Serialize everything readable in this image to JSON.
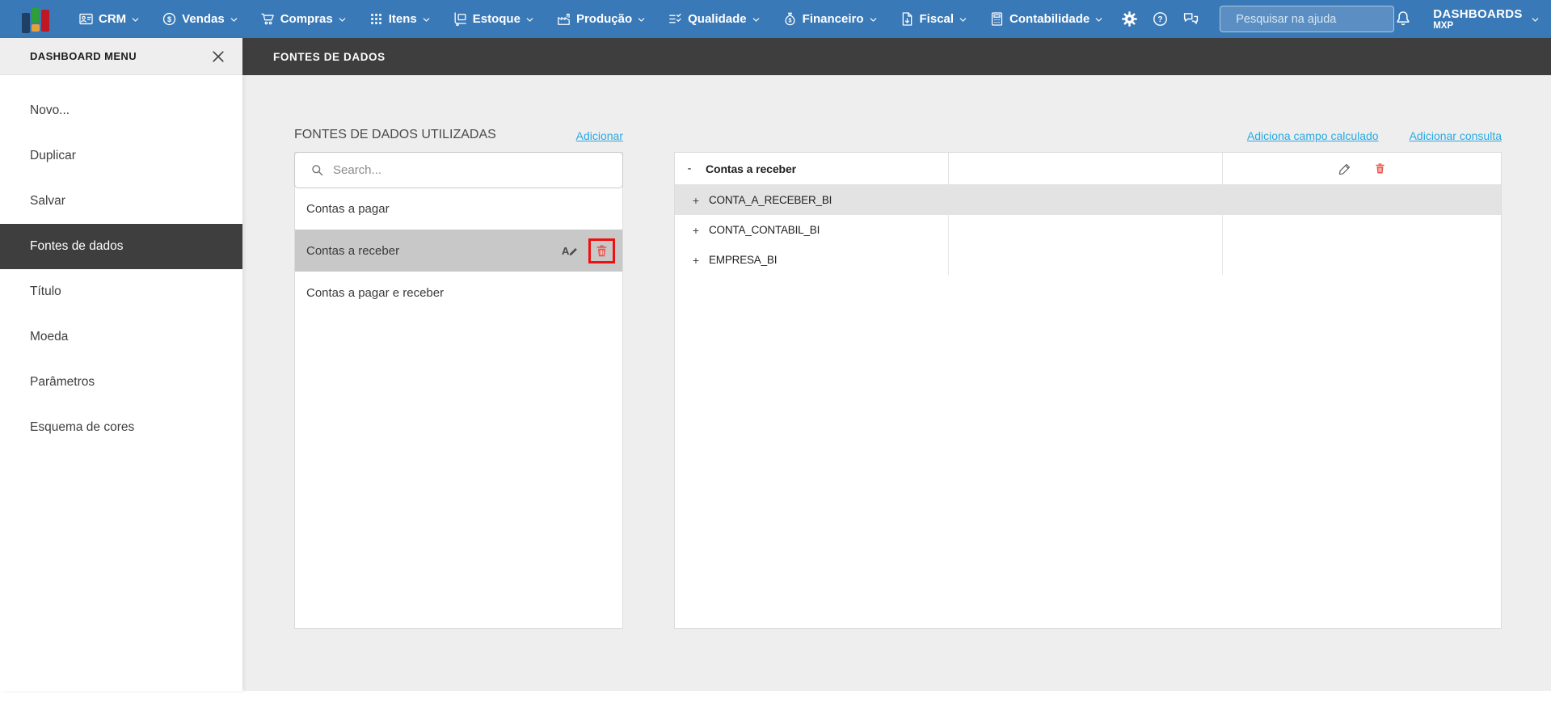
{
  "topnav": {
    "items": [
      {
        "label": "CRM",
        "icon": "crm-icon"
      },
      {
        "label": "Vendas",
        "icon": "sales-icon"
      },
      {
        "label": "Compras",
        "icon": "purchases-icon"
      },
      {
        "label": "Itens",
        "icon": "items-icon"
      },
      {
        "label": "Estoque",
        "icon": "stock-icon"
      },
      {
        "label": "Produção",
        "icon": "production-icon"
      },
      {
        "label": "Qualidade",
        "icon": "quality-icon"
      },
      {
        "label": "Financeiro",
        "icon": "finance-icon"
      },
      {
        "label": "Fiscal",
        "icon": "fiscal-icon"
      },
      {
        "label": "Contabilidade",
        "icon": "accounting-icon"
      }
    ],
    "tools": [
      "gear-icon",
      "help-icon",
      "chat-icon"
    ],
    "search": {
      "placeholder": "Pesquisar na ajuda"
    },
    "user": {
      "title": "DASHBOARDS",
      "subtitle": "MXP"
    }
  },
  "sidebar": {
    "title": "DASHBOARD MENU",
    "items": [
      {
        "label": "Novo...",
        "selected": false
      },
      {
        "label": "Duplicar",
        "selected": false
      },
      {
        "label": "Salvar",
        "selected": false
      },
      {
        "label": "Fontes de dados",
        "selected": true
      },
      {
        "label": "Título",
        "selected": false
      },
      {
        "label": "Moeda",
        "selected": false
      },
      {
        "label": "Parâmetros",
        "selected": false
      },
      {
        "label": "Esquema de cores",
        "selected": false
      }
    ]
  },
  "header": {
    "title": "FONTES DE DADOS"
  },
  "sources_panel": {
    "heading": "FONTES DE DADOS UTILIZADAS",
    "add_link": "Adicionar",
    "search_placeholder": "Search...",
    "items": [
      {
        "label": "Contas a pagar",
        "selected": false
      },
      {
        "label": "Contas a receber",
        "selected": true,
        "actions": [
          "rename-icon",
          "trash-icon"
        ],
        "trash_highlighted": true
      },
      {
        "label": "Contas a pagar e receber",
        "selected": false
      }
    ]
  },
  "detail_panel": {
    "add_calculated_field_link": "Adiciona campo calculado",
    "add_query_link": "Adicionar consulta",
    "tree": {
      "root": {
        "expand_symbol": "-",
        "label": "Contas a receber",
        "actions": [
          "pencil-icon",
          "trash-icon"
        ]
      },
      "children": [
        {
          "expand_symbol": "+",
          "label": "CONTA_A_RECEBER_BI",
          "selected": true
        },
        {
          "expand_symbol": "+",
          "label": "CONTA_CONTABIL_BI",
          "selected": false
        },
        {
          "expand_symbol": "+",
          "label": "EMPRESA_BI",
          "selected": false
        }
      ]
    }
  },
  "colors": {
    "topbar_blue": "#3a79b7",
    "dark_bar": "#3e3e3e",
    "content_bg": "#eeeeee",
    "link_blue": "#29a9e2",
    "selected_source_row": "#c8c8c8",
    "selected_tree_row": "#e3e3e3",
    "danger_red": "#e8544a",
    "highlight_border_red": "#ee1111"
  }
}
